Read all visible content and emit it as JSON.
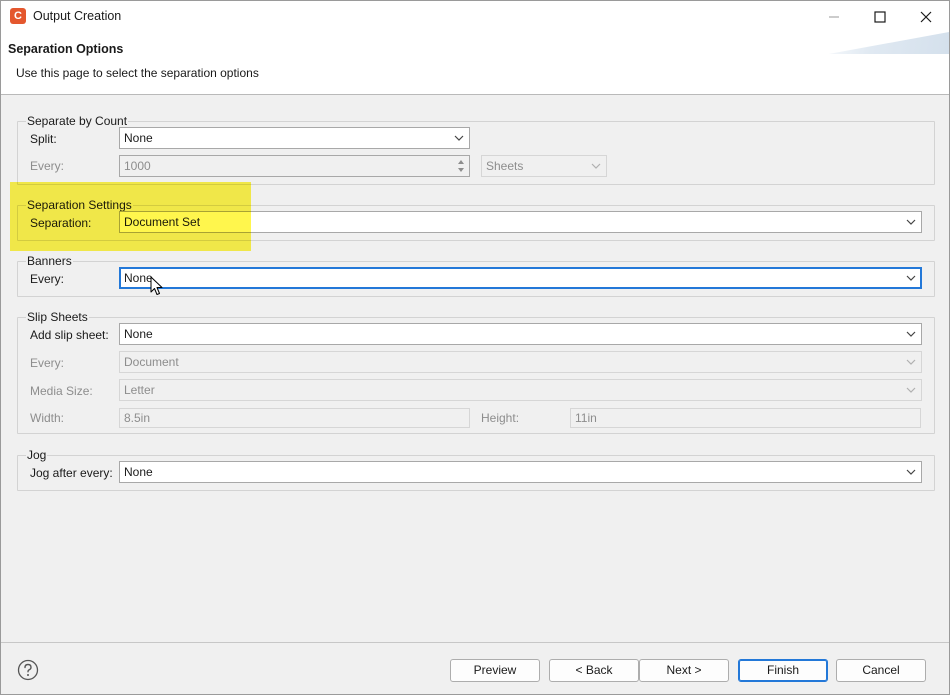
{
  "window": {
    "title": "Output Creation",
    "app_icon_letter": "C",
    "accent_color": "#2378d8",
    "app_icon_color": "#e4572e"
  },
  "header": {
    "title": "Separation Options",
    "description": "Use this page to select the separation options"
  },
  "separate_by_count": {
    "title": "Separate by Count",
    "split_label": "Split:",
    "split_value": "None",
    "every_label": "Every:",
    "every_value": "1000",
    "unit_value": "Sheets"
  },
  "separation_settings": {
    "title": "Separation Settings",
    "separation_label": "Separation:",
    "separation_value": "Document Set",
    "highlight_color": "#fff426"
  },
  "banners": {
    "title": "Banners",
    "every_label": "Every:",
    "every_value": "None"
  },
  "slip_sheets": {
    "title": "Slip Sheets",
    "add_label": "Add slip sheet:",
    "add_value": "None",
    "every_label": "Every:",
    "every_value": "Document",
    "media_label": "Media Size:",
    "media_value": "Letter",
    "width_label": "Width:",
    "width_value": "8.5in",
    "height_label": "Height:",
    "height_value": "11in"
  },
  "jog": {
    "title": "Jog",
    "after_label": "Jog after every:",
    "after_value": "None"
  },
  "footer": {
    "preview": "Preview",
    "back": "< Back",
    "next": "Next >",
    "finish": "Finish",
    "cancel": "Cancel"
  }
}
